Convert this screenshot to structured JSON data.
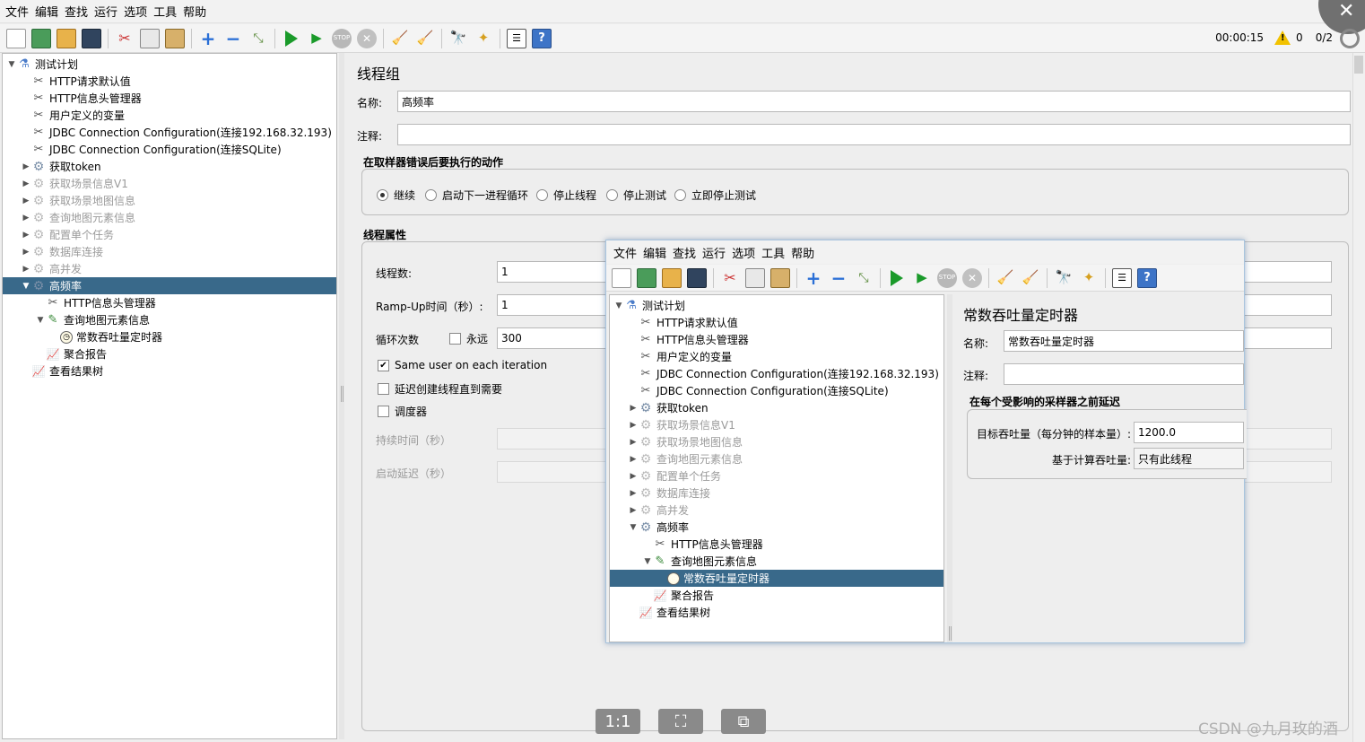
{
  "menu": [
    "文件",
    "编辑",
    "查找",
    "运行",
    "选项",
    "工具",
    "帮助"
  ],
  "status": {
    "time": "00:00:15",
    "warnings": "0",
    "threads": "0/2"
  },
  "overlay": {
    "close_glyph": "✕"
  },
  "tree": [
    {
      "label": "测试计划",
      "icon": "test-plan-icon",
      "level": 0,
      "toggle": "▼",
      "state": "normal"
    },
    {
      "label": "HTTP请求默认值",
      "icon": "config-tool-icon",
      "level": 1,
      "toggle": "",
      "state": "normal"
    },
    {
      "label": "HTTP信息头管理器",
      "icon": "config-tool-icon",
      "level": 1,
      "toggle": "",
      "state": "normal"
    },
    {
      "label": "用户定义的变量",
      "icon": "config-tool-icon",
      "level": 1,
      "toggle": "",
      "state": "normal"
    },
    {
      "label": "JDBC Connection Configuration(连接192.168.32.193)",
      "icon": "config-tool-icon",
      "level": 1,
      "toggle": "",
      "state": "normal"
    },
    {
      "label": "JDBC Connection Configuration(连接SQLite)",
      "icon": "config-tool-icon",
      "level": 1,
      "toggle": "",
      "state": "normal"
    },
    {
      "label": "获取token",
      "icon": "thread-group-gear-icon",
      "level": 1,
      "toggle": "▶",
      "state": "normal"
    },
    {
      "label": "获取场景信息V1",
      "icon": "thread-group-gear-icon",
      "level": 1,
      "toggle": "▶",
      "state": "disabled"
    },
    {
      "label": "获取场景地图信息",
      "icon": "thread-group-gear-icon",
      "level": 1,
      "toggle": "▶",
      "state": "disabled"
    },
    {
      "label": "查询地图元素信息",
      "icon": "thread-group-gear-icon",
      "level": 1,
      "toggle": "▶",
      "state": "disabled"
    },
    {
      "label": "配置单个任务",
      "icon": "thread-group-gear-icon",
      "level": 1,
      "toggle": "▶",
      "state": "disabled"
    },
    {
      "label": "数据库连接",
      "icon": "thread-group-gear-icon",
      "level": 1,
      "toggle": "▶",
      "state": "disabled"
    },
    {
      "label": "高并发",
      "icon": "thread-group-gear-icon",
      "level": 1,
      "toggle": "▶",
      "state": "disabled"
    },
    {
      "label": "高频率",
      "icon": "thread-group-gear-icon",
      "level": 1,
      "toggle": "▼",
      "state": "selected"
    },
    {
      "label": "HTTP信息头管理器",
      "icon": "config-tool-icon",
      "level": 2,
      "toggle": "",
      "state": "normal"
    },
    {
      "label": "查询地图元素信息",
      "icon": "sampler-pen-icon",
      "level": 2,
      "toggle": "▼",
      "state": "normal"
    },
    {
      "label": "常数吞吐量定时器",
      "icon": "timer-icon",
      "level": 3,
      "toggle": "",
      "state": "normal"
    },
    {
      "label": "聚合报告",
      "icon": "report-chart-icon",
      "level": 2,
      "toggle": "",
      "state": "normal"
    },
    {
      "label": "查看结果树",
      "icon": "report-chart-icon",
      "level": 1,
      "toggle": "",
      "state": "normal"
    }
  ],
  "tg": {
    "title": "线程组",
    "name_label": "名称:",
    "name_value": "高频率",
    "comment_label": "注释:",
    "comment_value": "",
    "error_section": "在取样器错误后要执行的动作",
    "error_options": [
      {
        "label": "继续",
        "checked": true
      },
      {
        "label": "启动下一进程循环",
        "checked": false
      },
      {
        "label": "停止线程",
        "checked": false
      },
      {
        "label": "停止测试",
        "checked": false
      },
      {
        "label": "立即停止测试",
        "checked": false
      }
    ],
    "props_section": "线程属性",
    "threads_label": "线程数:",
    "threads_value": "1",
    "rampup_label": "Ramp-Up时间（秒）:",
    "rampup_value": "1",
    "loop_label": "循环次数",
    "forever_label": "永远",
    "loop_value": "300",
    "same_user_label": "Same user on each iteration",
    "delay_label": "延迟创建线程直到需要",
    "scheduler_label": "调度器",
    "duration_label": "持续时间（秒）",
    "startup_label": "启动延迟（秒）"
  },
  "popup": {
    "menu": [
      "文件",
      "编辑",
      "查找",
      "运行",
      "选项",
      "工具",
      "帮助"
    ],
    "tree": [
      {
        "label": "测试计划",
        "icon": "test-plan-icon",
        "level": 0,
        "toggle": "▼",
        "state": "normal"
      },
      {
        "label": "HTTP请求默认值",
        "icon": "config-tool-icon",
        "level": 1,
        "toggle": "",
        "state": "normal"
      },
      {
        "label": "HTTP信息头管理器",
        "icon": "config-tool-icon",
        "level": 1,
        "toggle": "",
        "state": "normal"
      },
      {
        "label": "用户定义的变量",
        "icon": "config-tool-icon",
        "level": 1,
        "toggle": "",
        "state": "normal"
      },
      {
        "label": "JDBC Connection Configuration(连接192.168.32.193)",
        "icon": "config-tool-icon",
        "level": 1,
        "toggle": "",
        "state": "normal"
      },
      {
        "label": "JDBC Connection Configuration(连接SQLite)",
        "icon": "config-tool-icon",
        "level": 1,
        "toggle": "",
        "state": "normal"
      },
      {
        "label": "获取token",
        "icon": "thread-group-gear-icon",
        "level": 1,
        "toggle": "▶",
        "state": "normal"
      },
      {
        "label": "获取场景信息V1",
        "icon": "thread-group-gear-icon",
        "level": 1,
        "toggle": "▶",
        "state": "disabled"
      },
      {
        "label": "获取场景地图信息",
        "icon": "thread-group-gear-icon",
        "level": 1,
        "toggle": "▶",
        "state": "disabled"
      },
      {
        "label": "查询地图元素信息",
        "icon": "thread-group-gear-icon",
        "level": 1,
        "toggle": "▶",
        "state": "disabled"
      },
      {
        "label": "配置单个任务",
        "icon": "thread-group-gear-icon",
        "level": 1,
        "toggle": "▶",
        "state": "disabled"
      },
      {
        "label": "数据库连接",
        "icon": "thread-group-gear-icon",
        "level": 1,
        "toggle": "▶",
        "state": "disabled"
      },
      {
        "label": "高并发",
        "icon": "thread-group-gear-icon",
        "level": 1,
        "toggle": "▶",
        "state": "disabled"
      },
      {
        "label": "高频率",
        "icon": "thread-group-gear-icon",
        "level": 1,
        "toggle": "▼",
        "state": "normal"
      },
      {
        "label": "HTTP信息头管理器",
        "icon": "config-tool-icon",
        "level": 2,
        "toggle": "",
        "state": "normal"
      },
      {
        "label": "查询地图元素信息",
        "icon": "sampler-pen-icon",
        "level": 2,
        "toggle": "▼",
        "state": "normal"
      },
      {
        "label": "常数吞吐量定时器",
        "icon": "timer-icon",
        "level": 3,
        "toggle": "",
        "state": "selected"
      },
      {
        "label": "聚合报告",
        "icon": "report-chart-icon",
        "level": 2,
        "toggle": "",
        "state": "normal"
      },
      {
        "label": "查看结果树",
        "icon": "report-chart-icon",
        "level": 1,
        "toggle": "",
        "state": "normal"
      }
    ],
    "timer": {
      "title": "常数吞吐量定时器",
      "name_label": "名称:",
      "name_value": "常数吞吐量定时器",
      "comment_label": "注释:",
      "comment_value": "",
      "section": "在每个受影响的采样器之前延迟",
      "target_label": "目标吞吐量（每分钟的样本量）:",
      "target_value": "1200.0",
      "calc_label": "基于计算吞吐量:",
      "calc_value": "只有此线程"
    }
  },
  "viewer_buttons": [
    "1:1",
    "⛶",
    "⧉"
  ],
  "watermark": "CSDN @九月玫的酒"
}
